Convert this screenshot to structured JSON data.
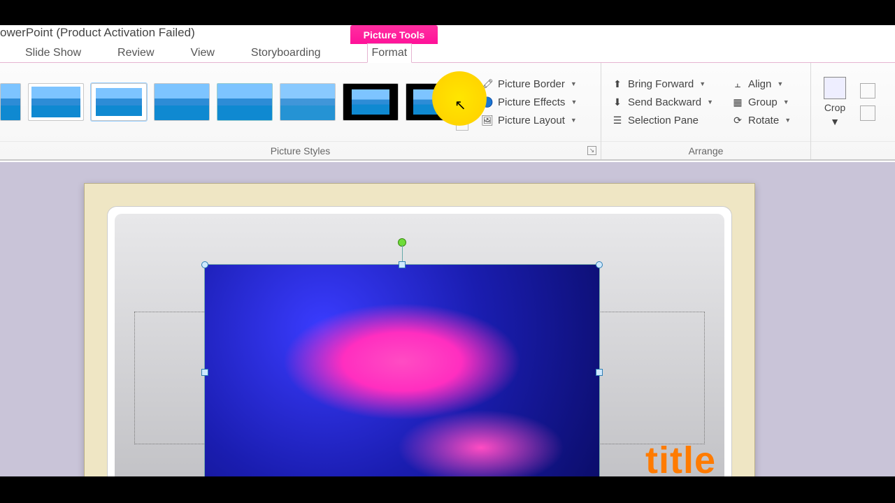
{
  "title": "owerPoint (Product Activation Failed)",
  "contextual_tab": "Picture Tools",
  "tabs": {
    "slide_show": "Slide Show",
    "review": "Review",
    "view": "View",
    "storyboarding": "Storyboarding",
    "format": "Format"
  },
  "groups": {
    "picture_styles": "Picture Styles",
    "arrange": "Arrange"
  },
  "buttons": {
    "picture_border": "Picture Border",
    "picture_effects": "Picture Effects",
    "picture_layout": "Picture Layout",
    "bring_forward": "Bring Forward",
    "send_backward": "Send Backward",
    "selection_pane": "Selection Pane",
    "align": "Align",
    "group": "Group",
    "rotate": "Rotate",
    "crop": "Crop"
  },
  "slide": {
    "title_text": "title"
  }
}
